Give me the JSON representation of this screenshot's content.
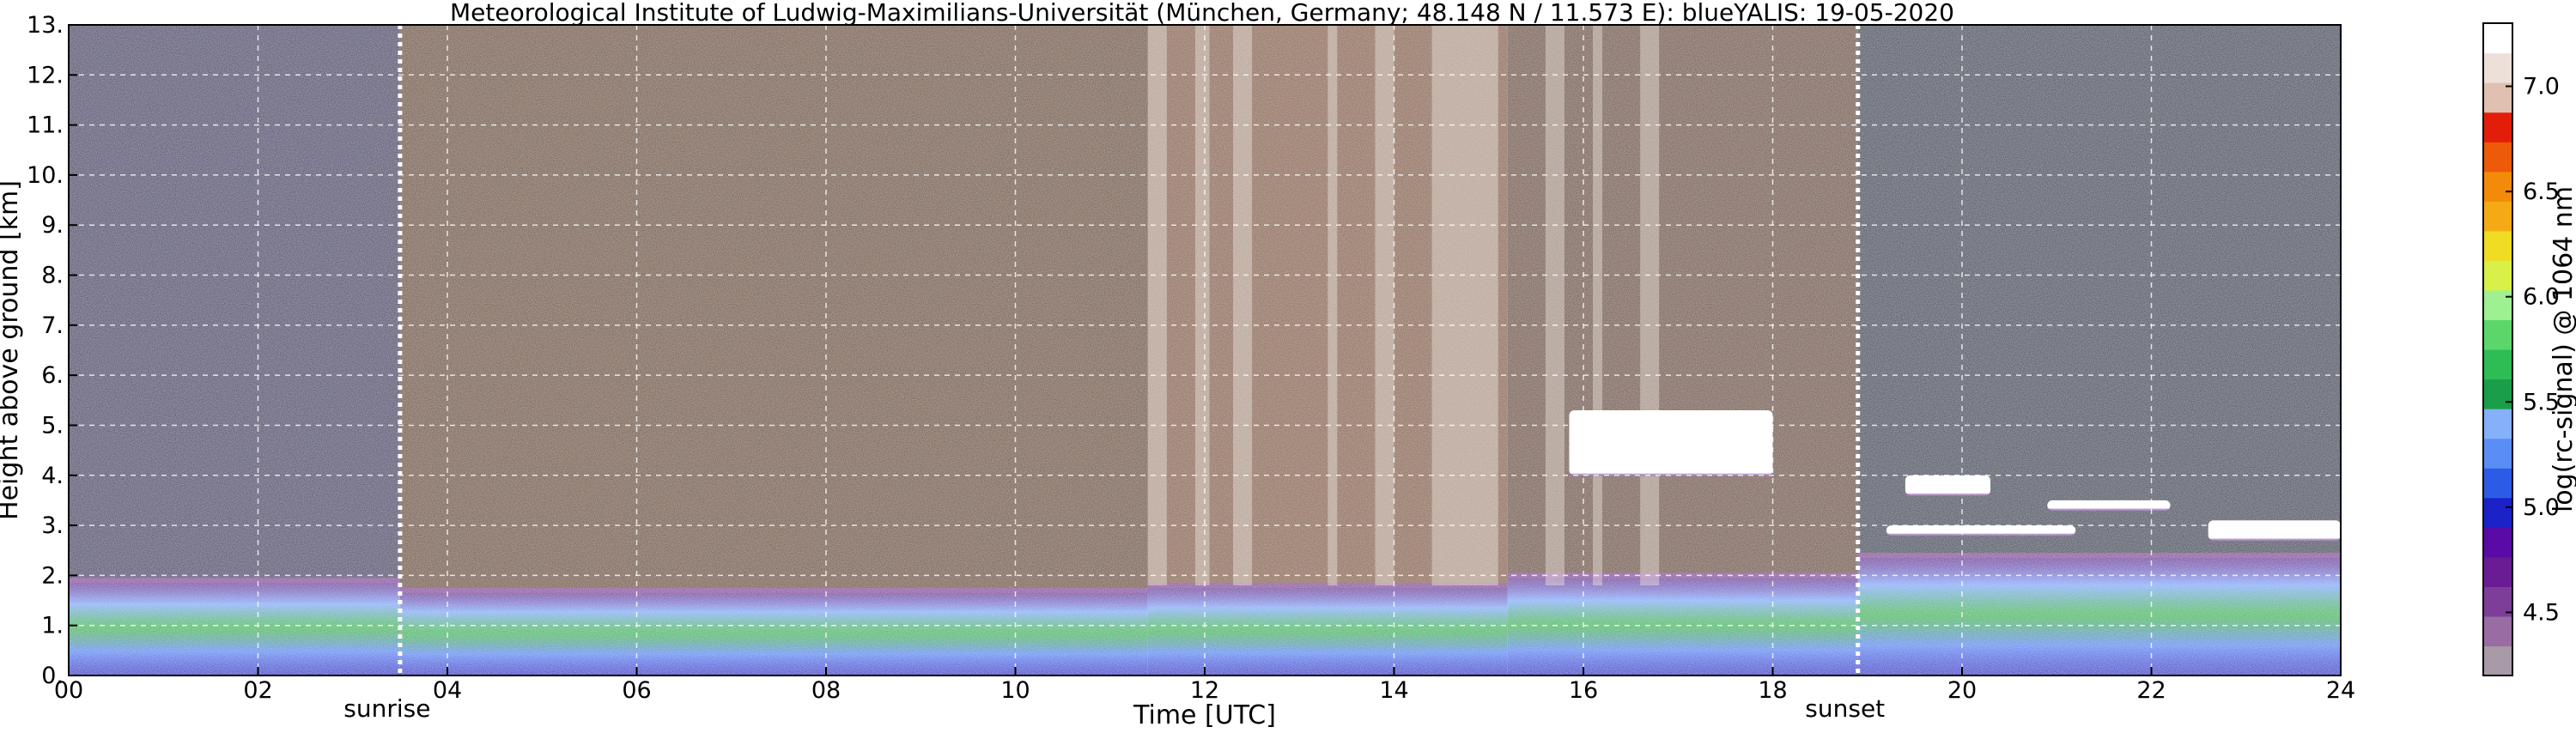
{
  "chart_data": {
    "type": "heatmap",
    "title": "Meteorological Institute of Ludwig-Maximilians-Universität (München, Germany; 48.148 N / 11.573 E):    blueYALIS: 19-05-2020",
    "xlabel": "Time [UTC]",
    "ylabel": "Height above ground [km]",
    "xlim": [
      0,
      24
    ],
    "ylim": [
      0,
      13
    ],
    "x_ticks": [
      0,
      2,
      4,
      6,
      8,
      10,
      12,
      14,
      16,
      18,
      20,
      22,
      24
    ],
    "x_tick_labels": [
      "00",
      "02",
      "04",
      "06",
      "08",
      "10",
      "12",
      "14",
      "16",
      "18",
      "20",
      "22",
      "24"
    ],
    "y_ticks": [
      0,
      1,
      2,
      3,
      4,
      5,
      6,
      7,
      8,
      9,
      10,
      11,
      12,
      13
    ],
    "y_tick_labels": [
      "0.",
      "1.",
      "2.",
      "3.",
      "4.",
      "5.",
      "6.",
      "7.",
      "8.",
      "9.",
      "10.",
      "11.",
      "12.",
      "13."
    ],
    "grid": true,
    "annotations": [
      {
        "text": "sunrise",
        "time": 3.5
      },
      {
        "text": "sunset",
        "time": 18.9
      }
    ],
    "colorbar": {
      "label": "log(rc-signal) @ 1064 nm",
      "range": [
        4.2,
        7.3
      ],
      "ticks": [
        4.5,
        5.0,
        5.5,
        6.0,
        6.5,
        7.0
      ],
      "tick_labels": [
        "4.5",
        "5.0",
        "5.5",
        "6.0",
        "6.5",
        "7.0"
      ],
      "colors": [
        "#a89aa6",
        "#9a6ca4",
        "#7d3e9a",
        "#6a1c94",
        "#5a0aa6",
        "#1a22c8",
        "#2c5ce6",
        "#5a8ef4",
        "#86b0fa",
        "#1a9e4a",
        "#2ebc54",
        "#5cd66a",
        "#9ef090",
        "#d8f048",
        "#f0dc22",
        "#f4aa14",
        "#f48a0a",
        "#ec5a0a",
        "#e21e0a",
        "#e0c0b0",
        "#ece0d8",
        "#ffffff"
      ]
    },
    "segments": [
      {
        "t0": 0.0,
        "t1": 3.5,
        "bl_top": 1.9,
        "top_color": "#3c3466"
      },
      {
        "t0": 3.5,
        "t1": 11.4,
        "bl_top": 1.7,
        "top_color": "#6e4a2a"
      },
      {
        "t0": 11.4,
        "t1": 15.2,
        "bl_top": 1.8,
        "top_color": "#8a5e40"
      },
      {
        "t0": 15.2,
        "t1": 18.9,
        "bl_top": 2.0,
        "top_color": "#6e4a34"
      },
      {
        "t0": 18.9,
        "t1": 24.0,
        "bl_top": 2.4,
        "top_color": "#2e3a52"
      }
    ],
    "clouds": [
      {
        "t0": 15.85,
        "t1": 18.0,
        "base": 4.0,
        "top": 5.3
      },
      {
        "t0": 19.4,
        "t1": 20.3,
        "base": 3.6,
        "top": 4.0
      },
      {
        "t0": 20.9,
        "t1": 22.2,
        "base": 3.3,
        "top": 3.5
      },
      {
        "t0": 19.2,
        "t1": 21.2,
        "base": 2.8,
        "top": 3.0
      },
      {
        "t0": 22.6,
        "t1": 24.0,
        "base": 2.7,
        "top": 3.1
      }
    ],
    "streaks": [
      {
        "t0": 11.4,
        "t1": 11.6
      },
      {
        "t0": 11.9,
        "t1": 12.05
      },
      {
        "t0": 12.3,
        "t1": 12.5
      },
      {
        "t0": 13.3,
        "t1": 13.4
      },
      {
        "t0": 13.8,
        "t1": 14.0
      },
      {
        "t0": 14.4,
        "t1": 15.1
      },
      {
        "t0": 15.6,
        "t1": 15.8
      },
      {
        "t0": 16.1,
        "t1": 16.2
      },
      {
        "t0": 16.6,
        "t1": 16.8
      }
    ]
  }
}
